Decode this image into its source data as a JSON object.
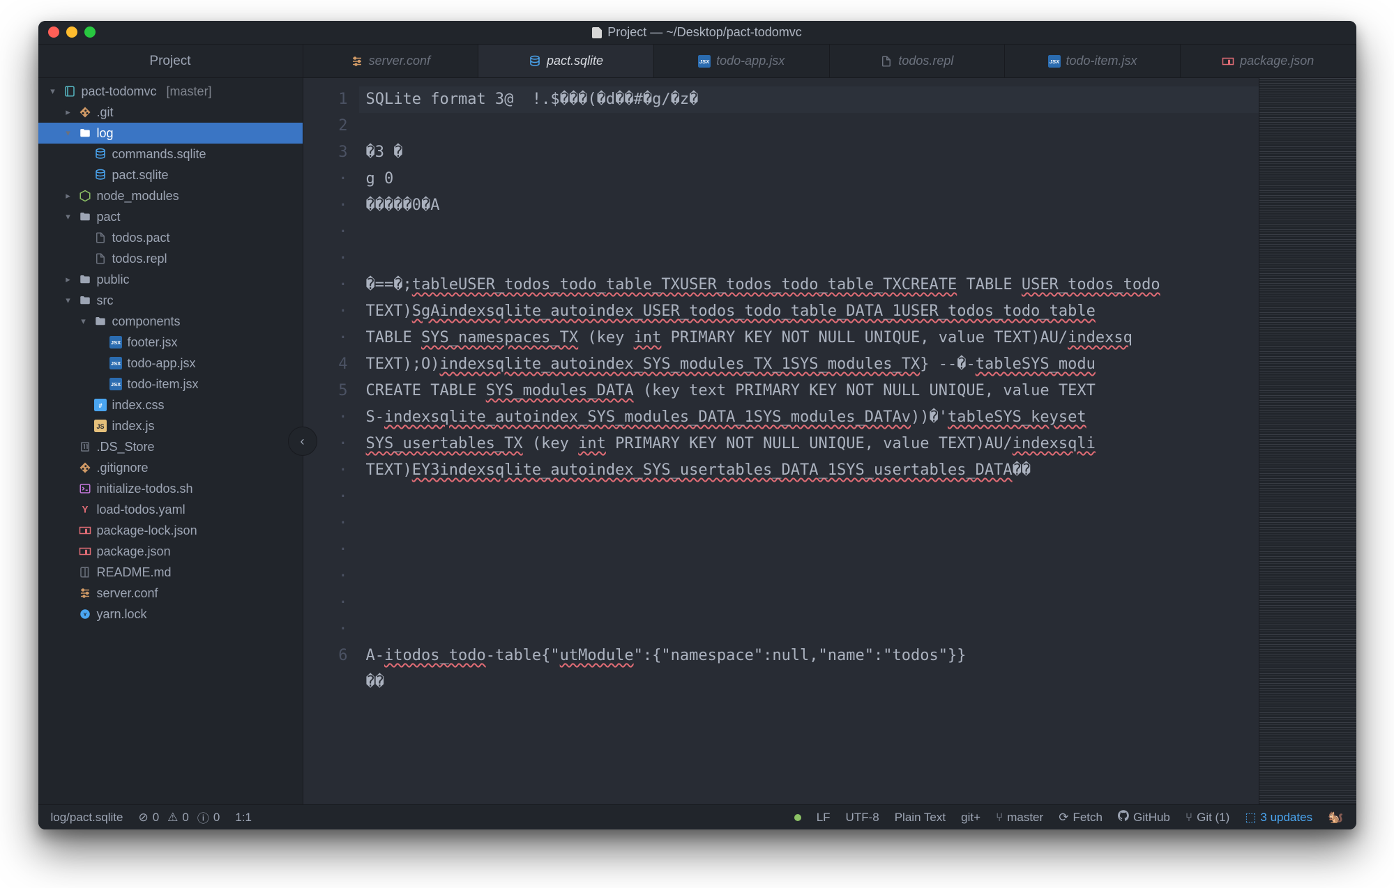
{
  "window": {
    "title": "Project — ~/Desktop/pact-todomvc"
  },
  "project_heading": "Project",
  "tabs": [
    {
      "label": "server.conf",
      "icon": "sliders",
      "iconClass": "c-orange",
      "active": false
    },
    {
      "label": "pact.sqlite",
      "icon": "database",
      "iconClass": "c-blue",
      "active": true
    },
    {
      "label": "todo-app.jsx",
      "icon": "jsx",
      "iconClass": "c-blue",
      "active": false
    },
    {
      "label": "todos.repl",
      "icon": "file",
      "iconClass": "c-gray",
      "active": false
    },
    {
      "label": "todo-item.jsx",
      "icon": "jsx",
      "iconClass": "c-blue",
      "active": false
    },
    {
      "label": "package.json",
      "icon": "npm",
      "iconClass": "c-red",
      "active": false
    }
  ],
  "tree": [
    {
      "depth": 0,
      "chev": "open",
      "icon": "repo",
      "iconClass": "c-teal",
      "label": "pact-todomvc",
      "suffix": "[master]",
      "selected": false
    },
    {
      "depth": 1,
      "chev": "closed",
      "icon": "git",
      "iconClass": "c-orange",
      "label": ".git"
    },
    {
      "depth": 1,
      "chev": "open",
      "icon": "folder",
      "iconClass": "",
      "label": "log",
      "selected": true
    },
    {
      "depth": 2,
      "chev": "none",
      "icon": "database",
      "iconClass": "c-blue",
      "label": "commands.sqlite"
    },
    {
      "depth": 2,
      "chev": "none",
      "icon": "database",
      "iconClass": "c-blue",
      "label": "pact.sqlite"
    },
    {
      "depth": 1,
      "chev": "closed",
      "icon": "node",
      "iconClass": "c-green",
      "label": "node_modules"
    },
    {
      "depth": 1,
      "chev": "open",
      "icon": "folder",
      "iconClass": "",
      "label": "pact"
    },
    {
      "depth": 2,
      "chev": "none",
      "icon": "file",
      "iconClass": "c-gray",
      "label": "todos.pact"
    },
    {
      "depth": 2,
      "chev": "none",
      "icon": "file",
      "iconClass": "c-gray",
      "label": "todos.repl"
    },
    {
      "depth": 1,
      "chev": "closed",
      "icon": "folder",
      "iconClass": "",
      "label": "public"
    },
    {
      "depth": 1,
      "chev": "open",
      "icon": "folder",
      "iconClass": "",
      "label": "src"
    },
    {
      "depth": 2,
      "chev": "open",
      "icon": "folder",
      "iconClass": "",
      "label": "components"
    },
    {
      "depth": 3,
      "chev": "none",
      "icon": "jsx",
      "iconClass": "c-blue",
      "label": "footer.jsx"
    },
    {
      "depth": 3,
      "chev": "none",
      "icon": "jsx",
      "iconClass": "c-blue",
      "label": "todo-app.jsx"
    },
    {
      "depth": 3,
      "chev": "none",
      "icon": "jsx",
      "iconClass": "c-blue",
      "label": "todo-item.jsx"
    },
    {
      "depth": 2,
      "chev": "none",
      "icon": "css",
      "iconClass": "c-blue",
      "label": "index.css"
    },
    {
      "depth": 2,
      "chev": "none",
      "icon": "js",
      "iconClass": "c-yellow",
      "label": "index.js"
    },
    {
      "depth": 1,
      "chev": "none",
      "icon": "binary",
      "iconClass": "c-gray",
      "label": ".DS_Store"
    },
    {
      "depth": 1,
      "chev": "none",
      "icon": "git",
      "iconClass": "c-orange",
      "label": ".gitignore"
    },
    {
      "depth": 1,
      "chev": "none",
      "icon": "terminal",
      "iconClass": "c-purple",
      "label": "initialize-todos.sh"
    },
    {
      "depth": 1,
      "chev": "none",
      "icon": "yaml",
      "iconClass": "c-red",
      "label": "load-todos.yaml"
    },
    {
      "depth": 1,
      "chev": "none",
      "icon": "npm",
      "iconClass": "c-red",
      "label": "package-lock.json"
    },
    {
      "depth": 1,
      "chev": "none",
      "icon": "npm",
      "iconClass": "c-red",
      "label": "package.json"
    },
    {
      "depth": 1,
      "chev": "none",
      "icon": "book",
      "iconClass": "c-gray",
      "label": "README.md"
    },
    {
      "depth": 1,
      "chev": "none",
      "icon": "sliders",
      "iconClass": "c-orange",
      "label": "server.conf"
    },
    {
      "depth": 1,
      "chev": "none",
      "icon": "yarn",
      "iconClass": "c-blue",
      "label": "yarn.lock"
    }
  ],
  "gutter": [
    "1",
    "2",
    "3",
    "·",
    "·",
    "·",
    "·",
    "·",
    "·",
    "·",
    "4",
    "5",
    "·",
    "·",
    "·",
    "·",
    "·",
    "·",
    "·",
    "·",
    "·",
    "6"
  ],
  "code_lines": [
    {
      "text": "SQLite format 3@  !.$���(�d��#�g∕�z�",
      "hl": true
    },
    {
      "text": "�3 �"
    },
    {
      "text": "g 0"
    },
    {
      "text": "�����0�A"
    },
    {
      "text": ""
    },
    {
      "text": ""
    },
    {
      "segments": [
        {
          "t": "�==�;"
        },
        {
          "t": "tableUSER_todos_todo_table_TXUSER_todos_todo_table_TXCREATE",
          "err": true
        },
        {
          "t": " TABLE "
        },
        {
          "t": "USER_todos_todo",
          "err": true
        }
      ]
    },
    {
      "segments": [
        {
          "t": "TEXT)"
        },
        {
          "t": "SgAindexsqlite_autoindex_USER_todos_todo_table_DATA_1USER_todos_todo_table",
          "err": true
        }
      ]
    },
    {
      "segments": [
        {
          "t": "TABLE "
        },
        {
          "t": "SYS_namespaces_TX",
          "err": true
        },
        {
          "t": " (key "
        },
        {
          "t": "int",
          "err": true
        },
        {
          "t": " PRIMARY KEY NOT NULL UNIQUE, value TEXT)AU/"
        },
        {
          "t": "indexsq",
          "err": true
        }
      ]
    },
    {
      "segments": [
        {
          "t": "TEXT);O)"
        },
        {
          "t": "indexsqlite_autoindex_SYS_modules_TX_1SYS_modules_TX",
          "err": true
        },
        {
          "t": "} --�-"
        },
        {
          "t": "tableSYS_modu",
          "err": true
        }
      ]
    },
    {
      "segments": [
        {
          "t": "CREATE TABLE "
        },
        {
          "t": "SYS_modules_DATA",
          "err": true
        },
        {
          "t": " (key text PRIMARY KEY NOT NULL UNIQUE, value TEXT"
        }
      ]
    },
    {
      "segments": [
        {
          "t": "S-"
        },
        {
          "t": "indexsqlite_autoindex_SYS_modules_DATA_1SYS_modules_DATAv",
          "err": true
        },
        {
          "t": "))�'"
        },
        {
          "t": "tableSYS_keyset",
          "err": true
        }
      ]
    },
    {
      "segments": [
        {
          "t": "SYS_usertables_TX",
          "err": true
        },
        {
          "t": " (key "
        },
        {
          "t": "int",
          "err": true
        },
        {
          "t": " PRIMARY KEY NOT NULL UNIQUE, value TEXT)AU/"
        },
        {
          "t": "indexsqli",
          "err": true
        }
      ]
    },
    {
      "segments": [
        {
          "t": "TEXT)"
        },
        {
          "t": "EY3indexsqlite_autoindex_SYS_usertables_DATA_1SYS_usertables_DATA",
          "err": true
        },
        {
          "t": "��"
        }
      ]
    },
    {
      "text": ""
    },
    {
      "text": ""
    },
    {
      "text": ""
    },
    {
      "text": ""
    },
    {
      "text": ""
    },
    {
      "text": ""
    },
    {
      "segments": [
        {
          "t": "A-"
        },
        {
          "t": "itodos_todo",
          "err": true
        },
        {
          "t": "-table{\""
        },
        {
          "t": "utModule",
          "err": true
        },
        {
          "t": "\":{\"namespace\":null,\"name\":\"todos\"}}"
        }
      ]
    },
    {
      "text": "��"
    }
  ],
  "status": {
    "left": {
      "path": "log/pact.sqlite",
      "diagnostics": {
        "forbid": "0",
        "warn": "0",
        "info": "0"
      },
      "cursor": "1:1"
    },
    "right": {
      "line_ending": "LF",
      "encoding": "UTF-8",
      "grammar": "Plain Text",
      "gitplus": "git+",
      "branch": "master",
      "fetch": "Fetch",
      "github": "GitHub",
      "git_changes": "Git (1)",
      "updates": "3 updates"
    }
  }
}
